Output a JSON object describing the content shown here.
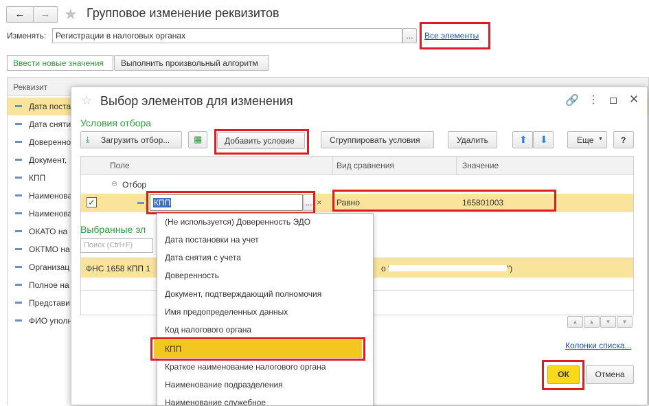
{
  "window": {
    "title": "Групповое изменение реквизитов",
    "change_label": "Изменять:",
    "change_value": "Регистрации в налоговых органах",
    "all_elements_link": "Все элементы",
    "tabs": [
      "Ввести новые значения",
      "Выполнить произвольный алгоритм"
    ],
    "table_header": "Реквизит",
    "rows": [
      "Дата поста",
      "Дата снятия",
      "Доверенно",
      "Документ,",
      "КПП",
      "Наименова",
      "Наименова",
      "ОКАТО на",
      "ОКТМО на",
      "Организац",
      "Полное на",
      "Представи",
      "ФИО уполн"
    ]
  },
  "dialog": {
    "title": "Выбор элементов для изменения",
    "filter_section": "Условия отбора",
    "toolbar": {
      "load": "Загрузить отбор...",
      "add_condition": "Добавить условие",
      "group_conditions": "Сгруппировать условия",
      "delete": "Удалить",
      "more": "Еще",
      "help": "?"
    },
    "grid_headers": {
      "field": "Поле",
      "comparison": "Вид сравнения",
      "value": "Значение"
    },
    "group_row": "Отбор",
    "condition": {
      "field": "КПП",
      "comparison": "Равно",
      "value": "165801003"
    },
    "selected_section": "Выбранные эл",
    "search_placeholder": "Поиск (Ctrl+F)",
    "selected_row_left": "ФНС 1658 КПП 1",
    "selected_row_right": "о \"",
    "selected_row_end": "\")",
    "columns_link": "Колонки списка...",
    "ok": "ОК",
    "cancel": "Отмена"
  },
  "dropdown": [
    "(Не используется) Доверенность ЭДО",
    "Дата постановки на учет",
    "Дата снятия с учета",
    "Доверенность",
    "Документ, подтверждающий полномочия",
    "Имя предопределенных данных",
    "Код налогового органа",
    "КПП",
    "Краткое наименование налогового органа",
    "Наименование подразделения",
    "Наименование служебное"
  ],
  "colors": {
    "accent_red": "#e01c23",
    "selected_yellow": "#fae49b",
    "highlight_yellow": "#f3c622",
    "ok_yellow": "#fcd81d",
    "section_green": "#2e9a3a"
  }
}
